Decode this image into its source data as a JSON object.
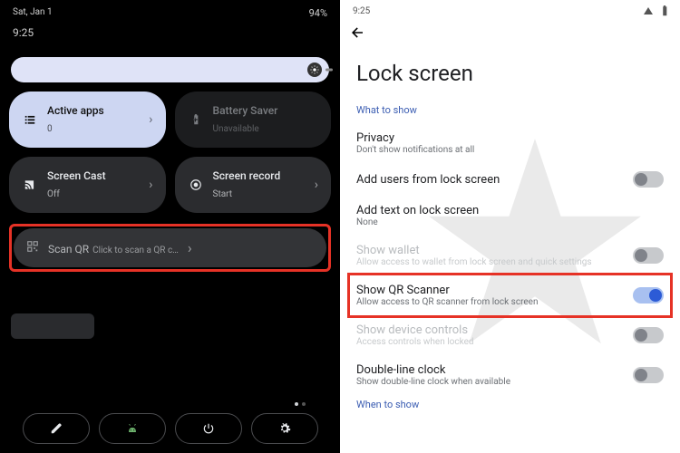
{
  "left": {
    "date": "Sat, Jan 1",
    "time": "9:25",
    "battery_pct": "94%",
    "tiles": {
      "active_apps": {
        "title": "Active apps",
        "sub": "0"
      },
      "battery_saver": {
        "title": "Battery Saver",
        "sub": "Unavailable"
      },
      "screen_cast": {
        "title": "Screen Cast",
        "sub": "Off"
      },
      "screen_record": {
        "title": "Screen record",
        "sub": "Start"
      },
      "scan_qr": {
        "title": "Scan QR",
        "sub": "Click to scan a QR c…"
      }
    }
  },
  "right": {
    "time": "9:25",
    "title": "Lock screen",
    "section_what": "What to show",
    "section_when": "When to show",
    "rows": {
      "privacy": {
        "title": "Privacy",
        "sub": "Don't show notifications at all"
      },
      "add_users": {
        "title": "Add users from lock screen"
      },
      "add_text": {
        "title": "Add text on lock screen",
        "sub": "None"
      },
      "show_wallet": {
        "title": "Show wallet",
        "sub": "Allow access to wallet from lock screen and quick settings"
      },
      "show_qr": {
        "title": "Show QR Scanner",
        "sub": "Allow access to QR scanner from lock screen"
      },
      "device_controls": {
        "title": "Show device controls",
        "sub": "Access controls when locked"
      },
      "double_clock": {
        "title": "Double-line clock",
        "sub": "Show double-line clock when available"
      }
    }
  }
}
